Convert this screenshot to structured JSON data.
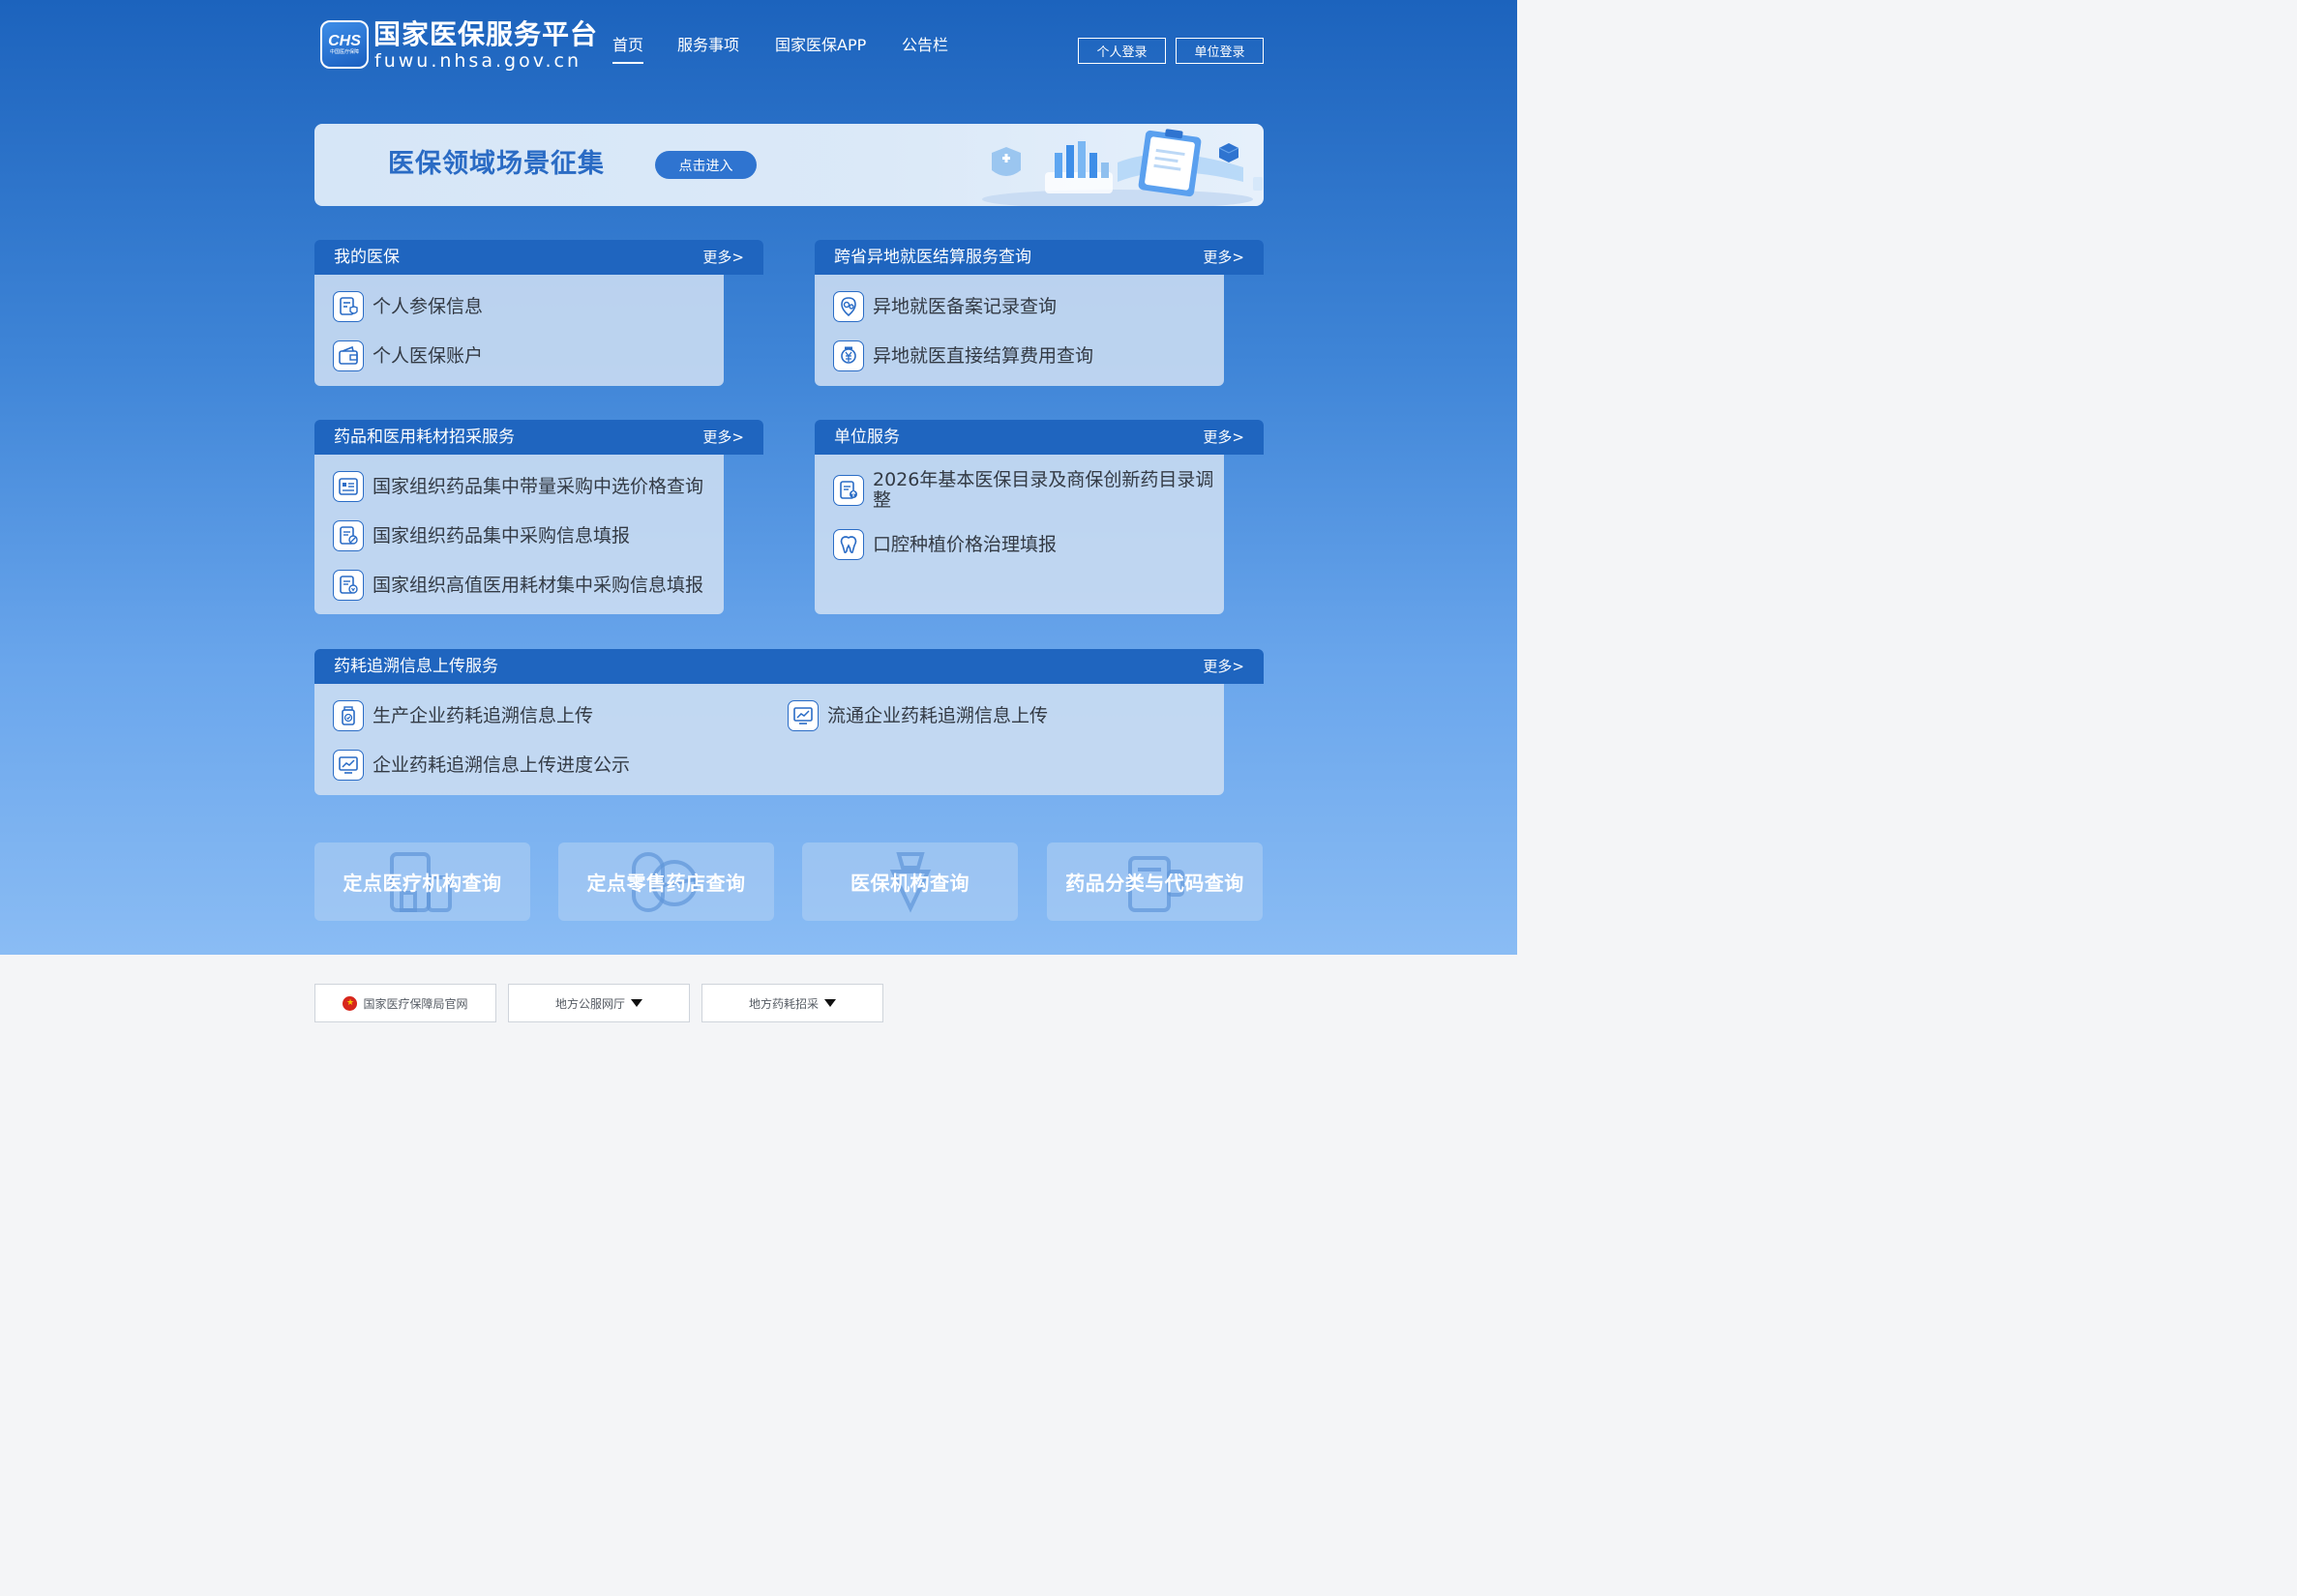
{
  "header": {
    "logo_mark": "CHS",
    "logo_sub": "中国医疗保障",
    "site_name": "国家医保服务平台",
    "site_domain": "fuwu.nhsa.gov.cn",
    "nav": [
      {
        "label": "首页",
        "active": true
      },
      {
        "label": "服务事项",
        "active": false
      },
      {
        "label": "国家医保APP",
        "active": false
      },
      {
        "label": "公告栏",
        "active": false
      }
    ],
    "personal_login": "个人登录",
    "unit_login": "单位登录"
  },
  "banner": {
    "title": "医保领域场景征集",
    "button": "点击进入"
  },
  "panels": [
    {
      "title": "我的医保",
      "more": "更多>",
      "items": [
        {
          "label": "个人参保信息",
          "icon": "insurance-doc-icon"
        },
        {
          "label": "个人医保账户",
          "icon": "wallet-icon"
        }
      ]
    },
    {
      "title": "跨省异地就医结算服务查询",
      "more": "更多>",
      "items": [
        {
          "label": "异地就医备案记录查询",
          "icon": "location-pin-icon"
        },
        {
          "label": "异地就医直接结算费用查询",
          "icon": "yuan-settlement-icon"
        }
      ]
    },
    {
      "title": "药品和医用耗材招采服务",
      "more": "更多>",
      "items": [
        {
          "label": "国家组织药品集中带量采购中选价格查询",
          "icon": "price-list-icon"
        },
        {
          "label": "国家组织药品集中采购信息填报",
          "icon": "drug-report-icon"
        },
        {
          "label": "国家组织高值医用耗材集中采购信息填报",
          "icon": "consumables-report-icon"
        }
      ]
    },
    {
      "title": "单位服务",
      "more": "更多>",
      "items": [
        {
          "label": "2026年基本医保目录及商保创新药目录调整",
          "icon": "catalog-upload-icon"
        },
        {
          "label": "口腔种植价格治理填报",
          "icon": "tooth-icon"
        }
      ]
    },
    {
      "title": "药耗追溯信息上传服务",
      "more": "更多>",
      "items": [
        {
          "label": "生产企业药耗追溯信息上传",
          "icon": "medicine-bottle-icon"
        },
        {
          "label": "流通企业药耗追溯信息上传",
          "icon": "trend-chart-icon"
        },
        {
          "label": "企业药耗追溯信息上传进度公示",
          "icon": "progress-chart-icon"
        }
      ]
    }
  ],
  "cards": [
    {
      "label": "定点医疗机构查询",
      "icon": "hospital-icon"
    },
    {
      "label": "定点零售药店查询",
      "icon": "pharmacy-icon"
    },
    {
      "label": "医保机构查询",
      "icon": "institution-icon"
    },
    {
      "label": "药品分类与代码查询",
      "icon": "drug-code-icon"
    }
  ],
  "footer": {
    "gov_site": "国家医疗保障局官网",
    "local_service": "地方公服网厅",
    "local_procurement": "地方药耗招采"
  },
  "colors": {
    "header_blue": "#1c63bd",
    "panel_head": "#1f65bf",
    "accent": "#2f74d0"
  }
}
